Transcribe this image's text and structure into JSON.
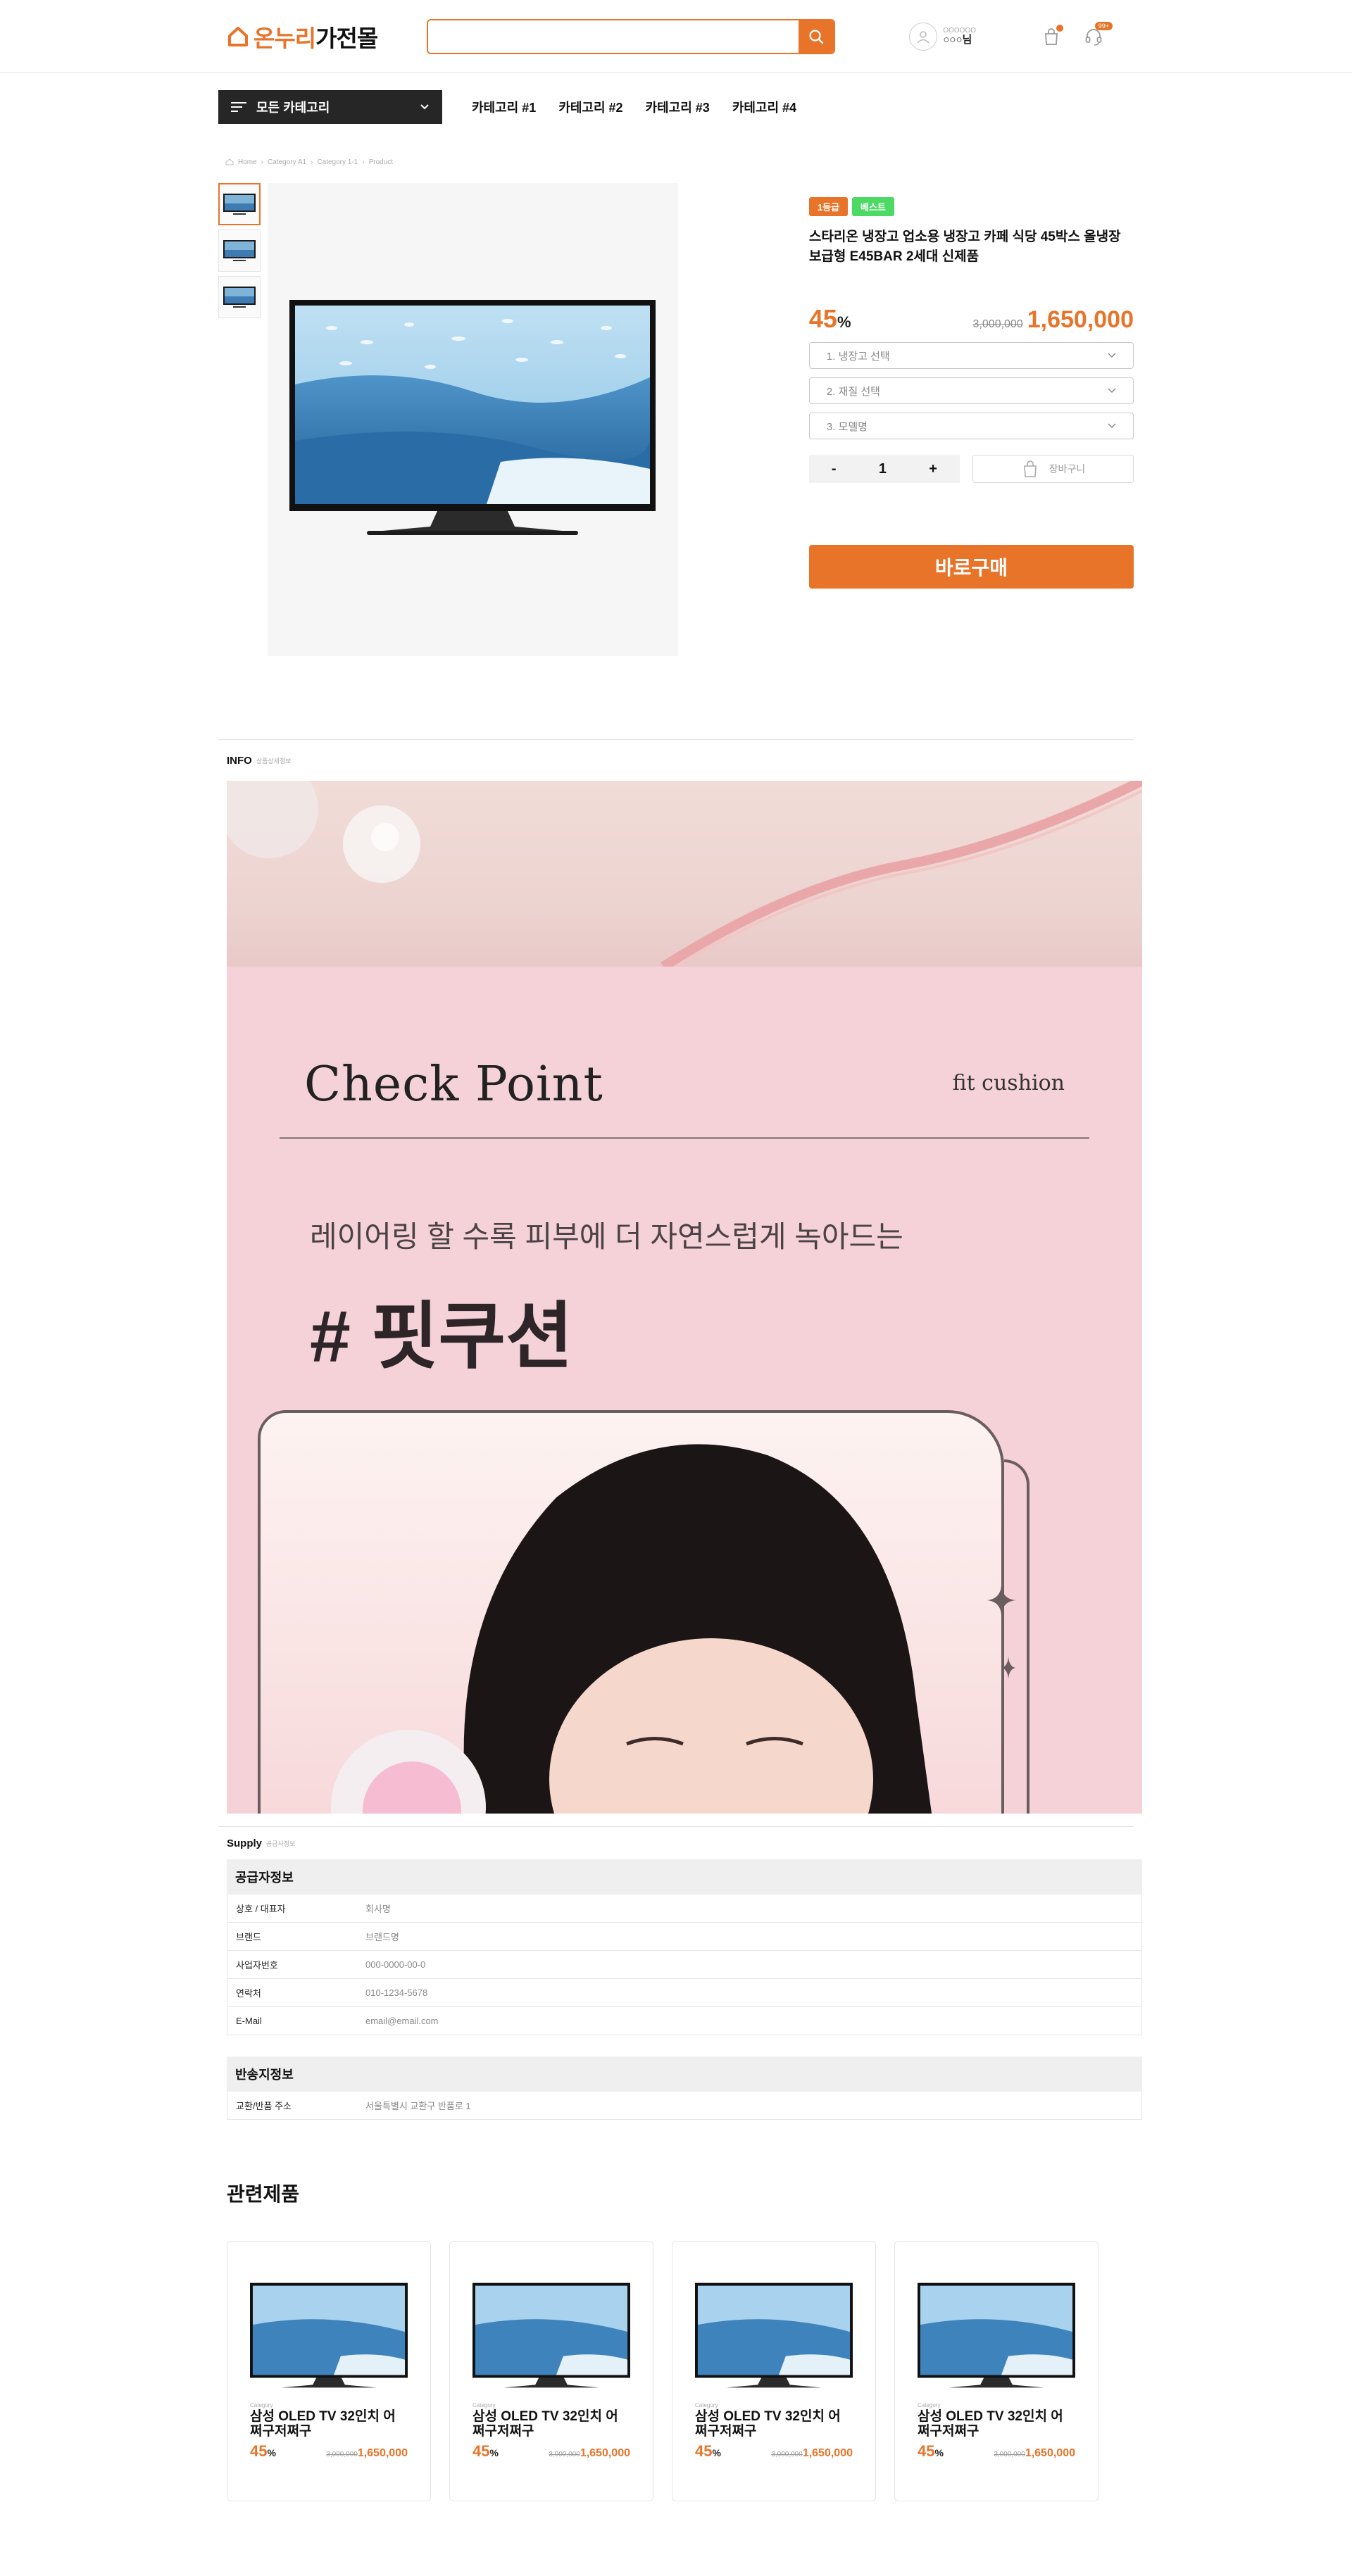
{
  "header": {
    "logo_accent": "온누리",
    "logo_main": "가전몰",
    "search_placeholder": "",
    "user_small": "OOOOOO",
    "user_name": "○○○님",
    "cart_badge": "",
    "chat_badge": "99+"
  },
  "nav": {
    "all_categories": "모든 카테고리",
    "links": [
      "카테고리 #1",
      "카테고리 #2",
      "카테고리 #3",
      "카테고리 #4"
    ]
  },
  "breadcrumb": {
    "home": "Home",
    "cat1": "Category A1",
    "cat2": "Category 1-1",
    "current": "Product"
  },
  "product": {
    "badges": [
      "1등급",
      "베스트"
    ],
    "title": "스타리온 냉장고 업소용 냉장고 카페  식당 45박스 올냉장 보급형 E45BAR 2세대 신제품",
    "discount": "45",
    "discount_unit": "%",
    "original_price": "3,000,000",
    "price": "1,650,000",
    "options": [
      "1. 냉장고 선택",
      "2. 재질 선택",
      "3. 모델명"
    ],
    "qty_minus": "-",
    "qty": "1",
    "qty_plus": "+",
    "cart_label": "장바구니",
    "buy_label": "바로구매"
  },
  "info_section": {
    "title": "INFO",
    "subtitle": "상품상세정보",
    "check_point": "Check Point",
    "fit_cushion": "fit cushion",
    "desc": "레이어링 할 수록 피부에 더 자연스럽게 녹아드는",
    "hash": "# 핏쿠션"
  },
  "supply_section": {
    "title": "Supply",
    "subtitle": "공급사정보",
    "supplier_header": "공급자정보",
    "supplier_rows": [
      {
        "k": "상호 / 대표자",
        "v": "회사명"
      },
      {
        "k": "브랜드",
        "v": "브랜드명"
      },
      {
        "k": "사업자번호",
        "v": "000-0000-00-0"
      },
      {
        "k": "연락처",
        "v": "010-1234-5678"
      },
      {
        "k": "E-Mail",
        "v": "email@email.com"
      }
    ],
    "return_header": "반송지정보",
    "return_rows": [
      {
        "k": "교환/반품 주소",
        "v": "서울특별시 교환구 반품로 1"
      }
    ]
  },
  "related": {
    "title": "관련제품",
    "items": [
      {
        "meta": "Category",
        "name": "삼성 OLED TV 32인치 어쩌구저쩌구",
        "discount": "45",
        "unit": "%",
        "old": "3,000,000",
        "price": "1,650,000"
      },
      {
        "meta": "Category",
        "name": "삼성 OLED TV 32인치 어쩌구저쩌구",
        "discount": "45",
        "unit": "%",
        "old": "3,000,000",
        "price": "1,650,000"
      },
      {
        "meta": "Category",
        "name": "삼성 OLED TV 32인치 어쩌구저쩌구",
        "discount": "45",
        "unit": "%",
        "old": "3,000,000",
        "price": "1,650,000"
      },
      {
        "meta": "Category",
        "name": "삼성 OLED TV 32인치 어쩌구저쩌구",
        "discount": "45",
        "unit": "%",
        "old": "3,000,000",
        "price": "1,650,000"
      }
    ]
  },
  "colors": {
    "accent": "#e8742a",
    "dark": "#262626",
    "badge_green": "#4cd964",
    "banner_pink": "#f5d1d8"
  },
  "icons": [
    "house-logo-icon",
    "search-icon",
    "user-icon",
    "bag-icon",
    "headset-icon",
    "menu-icon",
    "chevron-down-icon",
    "home-icon",
    "cart-icon"
  ]
}
